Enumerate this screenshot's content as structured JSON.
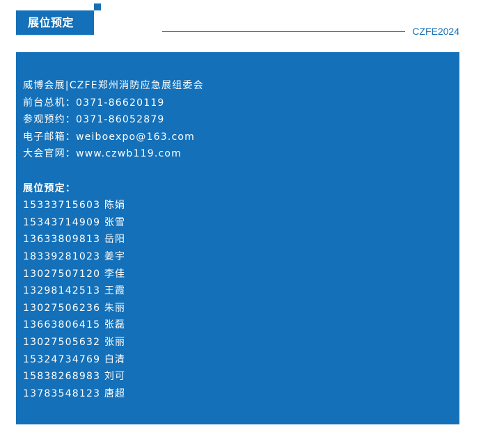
{
  "header": {
    "tab_title": "展位预定",
    "edition": "CZFE2024"
  },
  "contact": {
    "organizer": "威博会展|CZFE郑州消防应急展组委会",
    "reception": "前台总机：0371-86620119",
    "visit_booking": "参观预约：0371-86052879",
    "email": "电子邮箱：weiboexpo@163.com",
    "website": "大会官网：www.czwb119.com"
  },
  "booking": {
    "title": "展位预定：",
    "entries": [
      {
        "phone": "15333715603",
        "name": "陈娟"
      },
      {
        "phone": "15343714909",
        "name": "张雪"
      },
      {
        "phone": "13633809813",
        "name": "岳阳"
      },
      {
        "phone": "18339281023",
        "name": "姜宇"
      },
      {
        "phone": "13027507120",
        "name": "李佳"
      },
      {
        "phone": "13298142513",
        "name": "王霞"
      },
      {
        "phone": "13027506236",
        "name": "朱丽"
      },
      {
        "phone": "13663806415",
        "name": "张磊"
      },
      {
        "phone": "13027505632",
        "name": "张丽"
      },
      {
        "phone": "15324734769",
        "name": "白清"
      },
      {
        "phone": "15838268983",
        "name": "刘可"
      },
      {
        "phone": "13783548123",
        "name": "唐超"
      }
    ]
  },
  "colors": {
    "brand_blue": "#1470b8",
    "text_on_brand": "#ffffff"
  }
}
